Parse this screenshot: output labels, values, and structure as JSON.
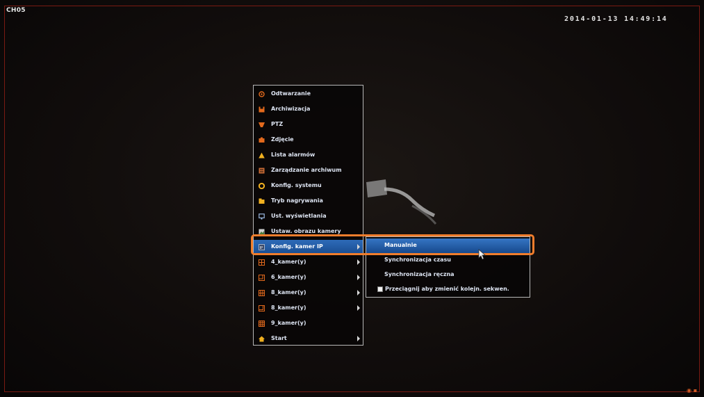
{
  "screen": {
    "channel_label": "CH05",
    "datetime": "2014-01-13 14:49:14",
    "frame_color": "#7a1a12"
  },
  "menu": {
    "items": [
      {
        "label": "Odtwarzanie",
        "icon": "playback-icon",
        "submenu": false
      },
      {
        "label": "Archiwizacja",
        "icon": "backup-icon",
        "submenu": false
      },
      {
        "label": "PTZ",
        "icon": "ptz-icon",
        "submenu": false
      },
      {
        "label": "Zdjęcie",
        "icon": "camera-snapshot-icon",
        "submenu": false
      },
      {
        "label": "Lista alarmów",
        "icon": "alarm-warning-icon",
        "submenu": false
      },
      {
        "label": "Zarządzanie archiwum",
        "icon": "archive-management-icon",
        "submenu": false
      },
      {
        "label": "Konfig. systemu",
        "icon": "system-config-icon",
        "submenu": false
      },
      {
        "label": "Tryb nagrywania",
        "icon": "record-mode-icon",
        "submenu": false
      },
      {
        "label": "Ust. wyświetlania",
        "icon": "display-monitor-icon",
        "submenu": false
      },
      {
        "label": "Ustaw. obrazu kamery",
        "icon": "image-settings-icon",
        "submenu": false
      },
      {
        "label": "Konfig. kamer IP",
        "icon": "ip-camera-icon",
        "submenu": true,
        "selected": true
      },
      {
        "label": "4_kamer(y)",
        "icon": "grid-4-icon",
        "submenu": true
      },
      {
        "label": "6_kamer(y)",
        "icon": "grid-6-icon",
        "submenu": true
      },
      {
        "label": "8_kamer(y)",
        "icon": "grid-8-icon",
        "submenu": true
      },
      {
        "label": "8_kamer(y)",
        "icon": "grid-8-alt-icon",
        "submenu": true
      },
      {
        "label": "9_kamer(y)",
        "icon": "grid-9-icon",
        "submenu": false
      },
      {
        "label": "Start",
        "icon": "home-icon",
        "submenu": true
      }
    ],
    "accent_color": "#f07d2c",
    "selected_color": "#2e6bb8"
  },
  "submenu": {
    "items": [
      {
        "label": "Manualnie",
        "selected": true
      },
      {
        "label": "Synchronizacja czasu"
      },
      {
        "label": "Synchronizacja ręczna"
      },
      {
        "label": "Przeciągnij aby zmienić kolejn. sekwen.",
        "checkbox": true,
        "checked": true
      }
    ]
  }
}
